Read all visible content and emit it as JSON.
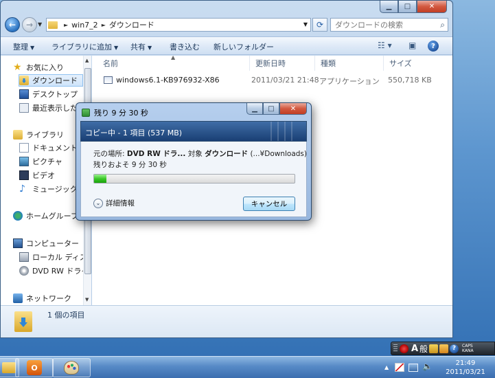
{
  "explorer": {
    "address": {
      "crumbs": [
        "win7_2",
        "ダウンロード"
      ]
    },
    "search_placeholder": "ダウンロードの検索",
    "commands": {
      "organize": "整理",
      "add_to_library": "ライブラリに追加",
      "share": "共有",
      "burn": "書き込む",
      "new_folder": "新しいフォルダー"
    },
    "nav": {
      "favorites": "お気に入り",
      "downloads": "ダウンロード",
      "desktop": "デスクトップ",
      "recent": "最近表示した場",
      "libraries": "ライブラリ",
      "documents": "ドキュメント",
      "pictures": "ピクチャ",
      "videos": "ビデオ",
      "music": "ミュージック",
      "homegroup": "ホームグループ",
      "computer": "コンピューター",
      "local_disk": "ローカル ディス",
      "dvd_drive": "DVD RW ドライ",
      "network": "ネットワーク"
    },
    "columns": {
      "name": "名前",
      "date_modified": "更新日時",
      "type": "種類",
      "size": "サイズ"
    },
    "files": [
      {
        "name": "windows6.1-KB976932-X86",
        "date_modified": "2011/03/21 21:48",
        "type": "アプリケーション",
        "size": "550,718 KB"
      }
    ],
    "details": {
      "item_count": "1 個の項目"
    }
  },
  "dialog": {
    "title": "残り 9 分 30 秒",
    "header": "コピー中 - 1 項目 (537 MB)",
    "from_label": "元の場所:",
    "from_value": "DVD RW ドラ...",
    "to_label": "対象",
    "to_value": "ダウンロード",
    "to_path": "(...¥Downloads)",
    "remaining": "残りおよそ 9 分 30 秒",
    "progress_percent": 6,
    "more_info_label": "詳細情報",
    "cancel_label": "キャンセル"
  },
  "langbar": {
    "mode": "A",
    "input": "般",
    "caps": "CAPS",
    "kana": "KANA"
  },
  "taskbar": {
    "media_label": "O",
    "clock_time": "21:49",
    "clock_date": "2011/03/21"
  },
  "colors": {
    "accent": "#2a72c0",
    "progress_fill": "#3cc82a",
    "dialog_header": "#1a3f74"
  }
}
